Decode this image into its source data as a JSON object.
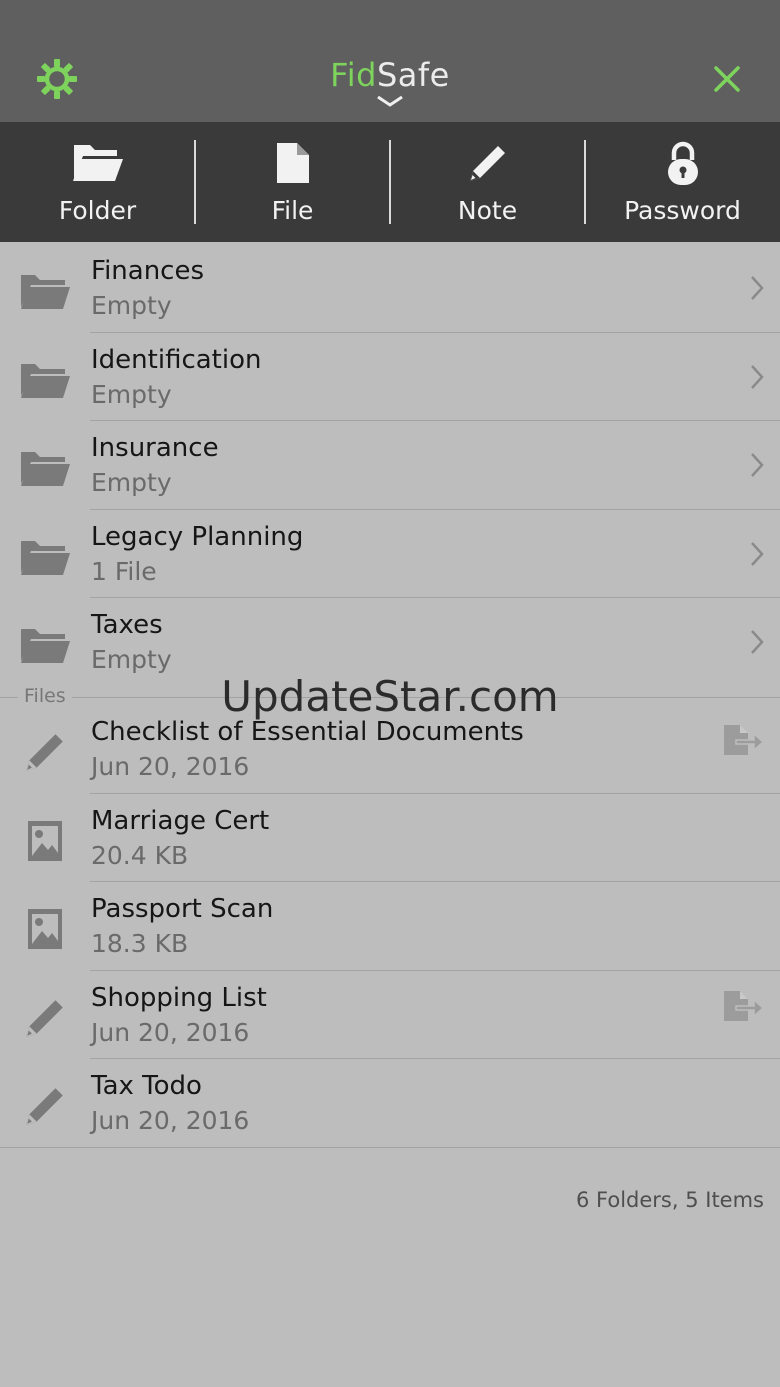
{
  "header": {
    "title_part1": "Fid",
    "title_part2": "Safe",
    "accent_color": "#7ed35d",
    "left_icon": "gear-icon",
    "right_icon": "close-icon"
  },
  "actions": [
    {
      "label": "Folder",
      "icon": "folder-open-icon"
    },
    {
      "label": "File",
      "icon": "file-icon"
    },
    {
      "label": "Note",
      "icon": "pencil-icon"
    },
    {
      "label": "Password",
      "icon": "lock-icon"
    }
  ],
  "folders": [
    {
      "name": "Finances",
      "sub": "Empty"
    },
    {
      "name": "Identification",
      "sub": "Empty"
    },
    {
      "name": "Insurance",
      "sub": "Empty"
    },
    {
      "name": "Legacy Planning",
      "sub": "1 File"
    },
    {
      "name": "Taxes",
      "sub": "Empty"
    }
  ],
  "files_section_label": "Files",
  "files": [
    {
      "name": "Checklist of Essential Documents",
      "sub": "Jun 20, 2016",
      "icon": "pencil-icon",
      "shared": true
    },
    {
      "name": "Marriage Cert",
      "sub": "20.4 KB",
      "icon": "image-icon",
      "shared": false
    },
    {
      "name": "Passport Scan",
      "sub": "18.3 KB",
      "icon": "image-icon",
      "shared": false
    },
    {
      "name": "Shopping List",
      "sub": "Jun 20, 2016",
      "icon": "pencil-icon",
      "shared": true
    },
    {
      "name": "Tax Todo",
      "sub": "Jun 20, 2016",
      "icon": "pencil-icon",
      "shared": false
    }
  ],
  "watermark": "UpdateStar.com",
  "summary": "6 Folders, 5 Items"
}
